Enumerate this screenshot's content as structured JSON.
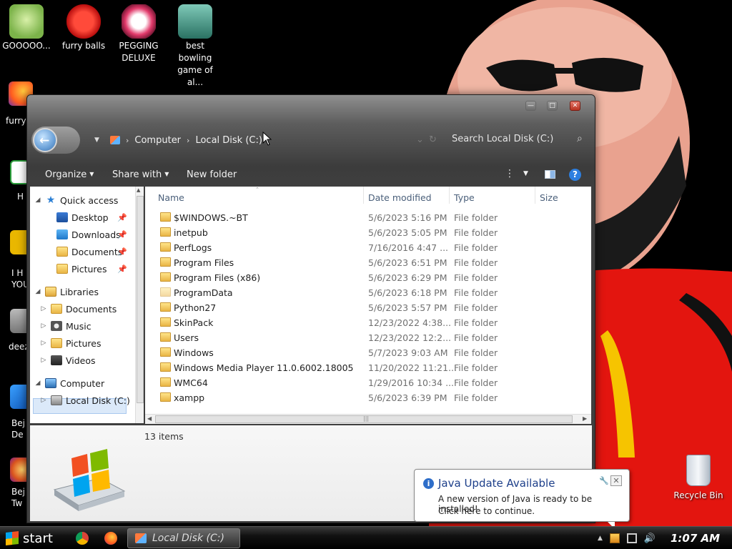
{
  "desktop": {
    "icons": [
      {
        "label": "GOOOOO..."
      },
      {
        "label": "furry balls"
      },
      {
        "label": "PEGGING DELUXE"
      },
      {
        "label": "best bowling game of al..."
      }
    ],
    "left_partial_labels": [
      "furry",
      "H",
      "I H\nYOU",
      "deez",
      "Bej\nDe",
      "Bej\nTw"
    ],
    "recycle_bin": "Recycle Bin"
  },
  "explorer": {
    "address": {
      "crumbs": [
        "Computer",
        "Local Disk (C:)"
      ]
    },
    "search_placeholder": "Search Local Disk (C:)",
    "toolbar": {
      "organize": "Organize",
      "share_with": "Share with",
      "new_folder": "New folder"
    },
    "nav": {
      "quick_access": "Quick access",
      "desktop": "Desktop",
      "downloads": "Downloads",
      "documents": "Documents",
      "pictures": "Pictures",
      "libraries": "Libraries",
      "lib_documents": "Documents",
      "lib_music": "Music",
      "lib_pictures": "Pictures",
      "lib_videos": "Videos",
      "computer": "Computer",
      "local_disk": "Local Disk (C:)"
    },
    "columns": {
      "name": "Name",
      "date": "Date modified",
      "type": "Type",
      "size": "Size"
    },
    "files": [
      {
        "name": "$WINDOWS.~BT",
        "date": "5/6/2023 5:16 PM",
        "type": "File folder"
      },
      {
        "name": "inetpub",
        "date": "5/6/2023 5:05 PM",
        "type": "File folder"
      },
      {
        "name": "PerfLogs",
        "date": "7/16/2016 4:47 ...",
        "type": "File folder"
      },
      {
        "name": "Program Files",
        "date": "5/6/2023 6:51 PM",
        "type": "File folder"
      },
      {
        "name": "Program Files (x86)",
        "date": "5/6/2023 6:29 PM",
        "type": "File folder"
      },
      {
        "name": "ProgramData",
        "date": "5/6/2023 6:18 PM",
        "type": "File folder"
      },
      {
        "name": "Python27",
        "date": "5/6/2023 5:57 PM",
        "type": "File folder"
      },
      {
        "name": "SkinPack",
        "date": "12/23/2022 4:38...",
        "type": "File folder"
      },
      {
        "name": "Users",
        "date": "12/23/2022 12:2...",
        "type": "File folder"
      },
      {
        "name": "Windows",
        "date": "5/7/2023 9:03 AM",
        "type": "File folder"
      },
      {
        "name": "Windows Media Player 11.0.6002.18005",
        "date": "11/20/2022 11:21...",
        "type": "File folder"
      },
      {
        "name": "WMC64",
        "date": "1/29/2016 10:34 ...",
        "type": "File folder"
      },
      {
        "name": "xampp",
        "date": "5/6/2023 6:39 PM",
        "type": "File folder"
      }
    ],
    "item_count": "13 items"
  },
  "java_balloon": {
    "title": "Java Update Available",
    "line1": "A new version of Java is ready to be installed!",
    "line2": "Click here to continue."
  },
  "taskbar": {
    "start": "start",
    "task_label": "Local Disk (C:)",
    "clock": "1:07 AM"
  }
}
